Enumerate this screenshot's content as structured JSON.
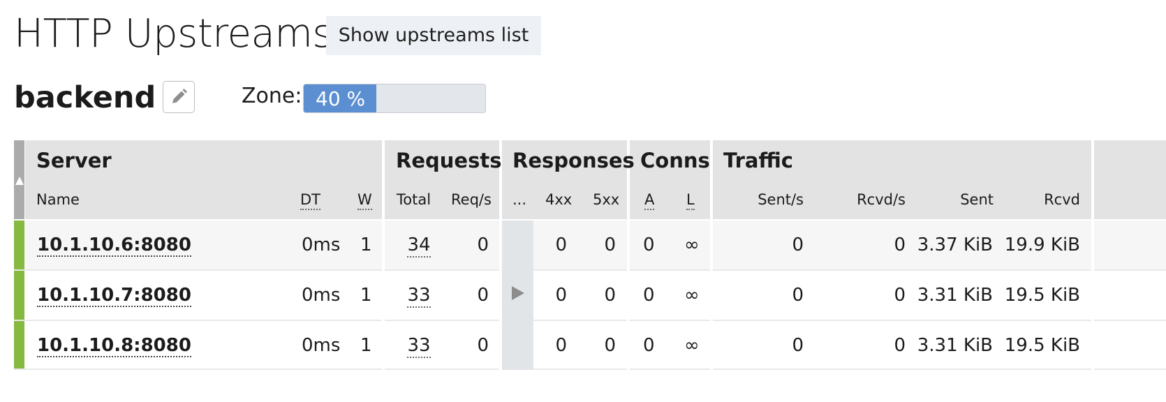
{
  "page": {
    "title": "HTTP Upstreams",
    "show_list_label": "Show upstreams list"
  },
  "upstream": {
    "name": "backend",
    "zone_label": "Zone:",
    "zone_usage": 40,
    "zone_usage_text": "40 %"
  },
  "table": {
    "groups": {
      "server": "Server",
      "requests": "Requests",
      "responses": "Responses",
      "conns": "Conns",
      "traffic": "Traffic"
    },
    "columns": {
      "name": "Name",
      "dt": "DT",
      "w": "W",
      "total": "Total",
      "reqs": "Req/s",
      "more": "...",
      "r4xx": "4xx",
      "r5xx": "5xx",
      "a": "A",
      "l": "L",
      "sent_s": "Sent/s",
      "rcvd_s": "Rcvd/s",
      "sent": "Sent",
      "rcvd": "Rcvd"
    },
    "rows": [
      {
        "server": "10.1.10.6:8080",
        "dt": "0ms",
        "w": "1",
        "total": "34",
        "reqs": "0",
        "r4xx": "0",
        "r5xx": "0",
        "a": "0",
        "l": "∞",
        "sent_s": "0",
        "rcvd_s": "0",
        "sent": "3.37 KiB",
        "rcvd": "19.9 KiB",
        "status_color": "#86b940"
      },
      {
        "server": "10.1.10.7:8080",
        "dt": "0ms",
        "w": "1",
        "total": "33",
        "reqs": "0",
        "r4xx": "0",
        "r5xx": "0",
        "a": "0",
        "l": "∞",
        "sent_s": "0",
        "rcvd_s": "0",
        "sent": "3.31 KiB",
        "rcvd": "19.5 KiB",
        "status_color": "#86b940"
      },
      {
        "server": "10.1.10.8:8080",
        "dt": "0ms",
        "w": "1",
        "total": "33",
        "reqs": "0",
        "r4xx": "0",
        "r5xx": "0",
        "a": "0",
        "l": "∞",
        "sent_s": "0",
        "rcvd_s": "0",
        "sent": "3.31 KiB",
        "rcvd": "19.5 KiB",
        "status_color": "#86b940"
      }
    ]
  },
  "colors": {
    "accent": "#5b8fd1",
    "status_up": "#86b940",
    "header_bg": "#e3e3e3"
  },
  "icons": {
    "edit": "pencil-icon",
    "sort": "sort-up-icon",
    "expand": "expand-right-icon"
  }
}
